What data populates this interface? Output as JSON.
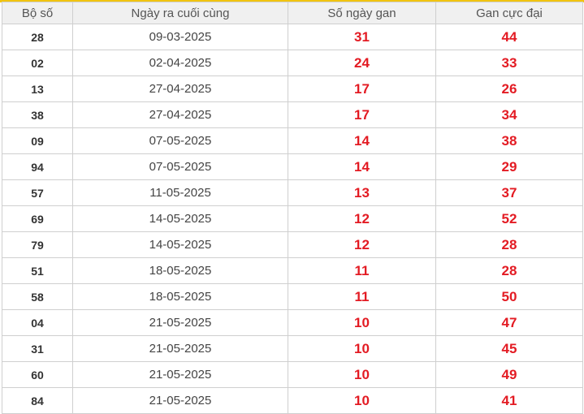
{
  "table": {
    "headers": [
      "Bộ số",
      "Ngày ra cuối cùng",
      "Số ngày gan",
      "Gan cực đại"
    ],
    "rows": [
      [
        "28",
        "09-03-2025",
        "31",
        "44"
      ],
      [
        "02",
        "02-04-2025",
        "24",
        "33"
      ],
      [
        "13",
        "27-04-2025",
        "17",
        "26"
      ],
      [
        "38",
        "27-04-2025",
        "17",
        "34"
      ],
      [
        "09",
        "07-05-2025",
        "14",
        "38"
      ],
      [
        "94",
        "07-05-2025",
        "14",
        "29"
      ],
      [
        "57",
        "11-05-2025",
        "13",
        "37"
      ],
      [
        "69",
        "14-05-2025",
        "12",
        "52"
      ],
      [
        "79",
        "14-05-2025",
        "12",
        "28"
      ],
      [
        "51",
        "18-05-2025",
        "11",
        "28"
      ],
      [
        "58",
        "18-05-2025",
        "11",
        "50"
      ],
      [
        "04",
        "21-05-2025",
        "10",
        "47"
      ],
      [
        "31",
        "21-05-2025",
        "10",
        "45"
      ],
      [
        "60",
        "21-05-2025",
        "10",
        "49"
      ],
      [
        "84",
        "21-05-2025",
        "10",
        "41"
      ]
    ]
  },
  "colors": {
    "accent": "#f1c40f",
    "header_bg": "#f0f0f0",
    "highlight_red": "#e31b23",
    "border": "#cfcfcf"
  }
}
